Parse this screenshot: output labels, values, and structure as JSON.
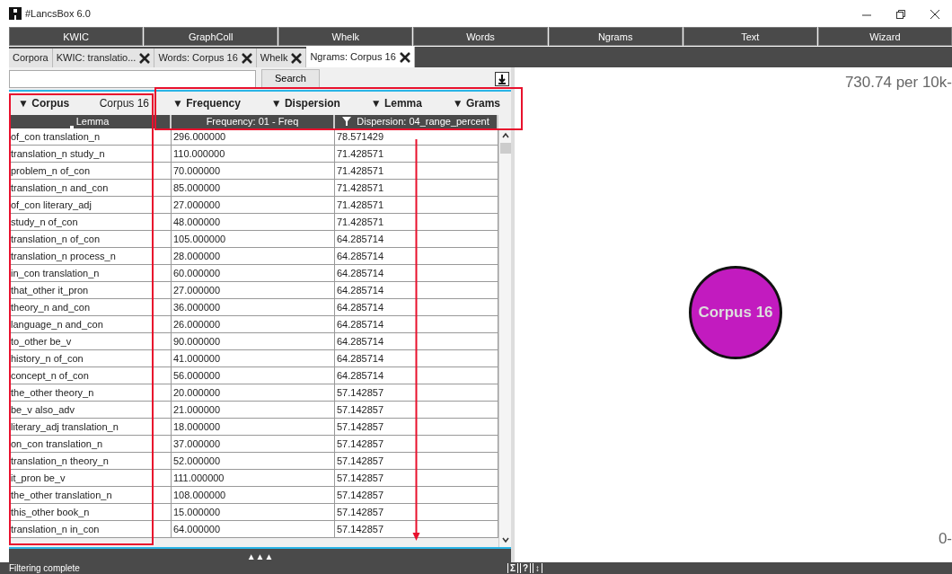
{
  "window": {
    "title": "#LancsBox 6.0"
  },
  "tools": [
    {
      "label": "KWIC"
    },
    {
      "label": "GraphColl"
    },
    {
      "label": "Whelk"
    },
    {
      "label": "Words"
    },
    {
      "label": "Ngrams"
    },
    {
      "label": "Text"
    },
    {
      "label": "Wizard"
    }
  ],
  "tabs": [
    {
      "label": "Corpora",
      "closable": false,
      "selected": false
    },
    {
      "label": "KWIC:  translatio...",
      "closable": true,
      "selected": false
    },
    {
      "label": "Words: Corpus 16",
      "closable": true,
      "selected": false
    },
    {
      "label": "Whelk",
      "closable": true,
      "selected": false
    },
    {
      "label": "Ngrams: Corpus 16",
      "closable": true,
      "selected": true
    }
  ],
  "search": {
    "button": "Search"
  },
  "filters": {
    "corpus_label": "▼ Corpus",
    "corpus_value": "Corpus 16",
    "items": [
      "▼ Frequency",
      "▼ Dispersion",
      "▼ Lemma",
      "▼ Grams"
    ]
  },
  "table": {
    "columns": [
      {
        "label": "Lemma",
        "sort_marker": true,
        "filtered": false
      },
      {
        "label": "Frequency: 01 - Freq",
        "sort_marker": false,
        "filtered": false
      },
      {
        "label": "Dispersion: 04_range_percent",
        "sort_marker": false,
        "filtered": true
      }
    ],
    "rows": [
      [
        "of_con translation_n",
        "296.000000",
        "78.571429"
      ],
      [
        "translation_n study_n",
        "110.000000",
        "71.428571"
      ],
      [
        "problem_n of_con",
        "70.000000",
        "71.428571"
      ],
      [
        "translation_n and_con",
        "85.000000",
        "71.428571"
      ],
      [
        "of_con literary_adj",
        "27.000000",
        "71.428571"
      ],
      [
        "study_n of_con",
        "48.000000",
        "71.428571"
      ],
      [
        "translation_n of_con",
        "105.000000",
        "64.285714"
      ],
      [
        "translation_n process_n",
        "28.000000",
        "64.285714"
      ],
      [
        "in_con translation_n",
        "60.000000",
        "64.285714"
      ],
      [
        "that_other it_pron",
        "27.000000",
        "64.285714"
      ],
      [
        "theory_n and_con",
        "36.000000",
        "64.285714"
      ],
      [
        "language_n and_con",
        "26.000000",
        "64.285714"
      ],
      [
        "to_other be_v",
        "90.000000",
        "64.285714"
      ],
      [
        "history_n of_con",
        "41.000000",
        "64.285714"
      ],
      [
        "concept_n of_con",
        "56.000000",
        "64.285714"
      ],
      [
        "the_other theory_n",
        "20.000000",
        "57.142857"
      ],
      [
        "be_v also_adv",
        "21.000000",
        "57.142857"
      ],
      [
        "literary_adj translation_n",
        "18.000000",
        "57.142857"
      ],
      [
        "on_con translation_n",
        "37.000000",
        "57.142857"
      ],
      [
        "translation_n theory_n",
        "52.000000",
        "57.142857"
      ],
      [
        "it_pron be_v",
        "111.000000",
        "57.142857"
      ],
      [
        "the_other translation_n",
        "108.000000",
        "57.142857"
      ],
      [
        "this_other book_n",
        "15.000000",
        "57.142857"
      ],
      [
        "translation_n in_con",
        "64.000000",
        "57.142857"
      ]
    ]
  },
  "expand_bar": {
    "label": "▲▲▲"
  },
  "graph": {
    "scale_top": "730.74 per 10k-",
    "scale_bottom": "0-",
    "nodes": [
      {
        "label": "Corpus 16",
        "color": "#c21bbf"
      }
    ]
  },
  "annotations": [
    {
      "kind": "box"
    },
    {
      "kind": "box"
    },
    {
      "kind": "arrow"
    }
  ],
  "status_bar": {
    "text": "Filtering complete",
    "buttons": [
      "Σ",
      "?",
      "↕"
    ]
  }
}
